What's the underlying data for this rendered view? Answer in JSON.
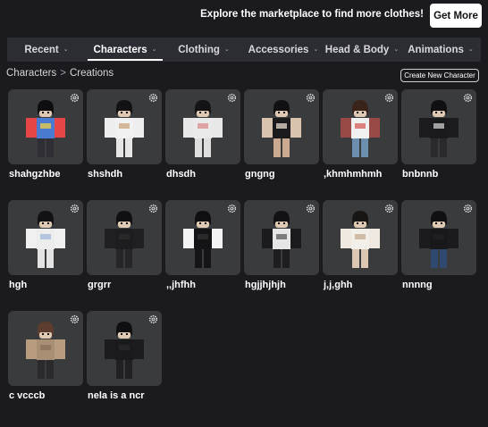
{
  "banner": {
    "text": "Explore the marketplace to find more clothes!",
    "button_label": "Get More"
  },
  "tabs": [
    {
      "label": "Recent",
      "active": false
    },
    {
      "label": "Characters",
      "active": true
    },
    {
      "label": "Clothing",
      "active": false
    },
    {
      "label": "Accessories",
      "active": false
    },
    {
      "label": "Head & Body",
      "active": false
    },
    {
      "label": "Animations",
      "active": false
    }
  ],
  "breadcrumb": {
    "parent": "Characters",
    "separator": ">",
    "current": "Creations"
  },
  "create_button": "Create New Character",
  "characters": [
    {
      "name": "shahgzhbe",
      "torso": "#4a7bd0",
      "arms": "#e64646",
      "legs": "#2e2e34",
      "hair": "#0e0e10",
      "accent": "#f2d046"
    },
    {
      "name": "shshdh",
      "torso": "#f1f1f1",
      "arms": "#eeeeee",
      "legs": "#e6e6e6",
      "hair": "#121214",
      "accent": "#c9a27a"
    },
    {
      "name": "dhsdh",
      "torso": "#eaeaea",
      "arms": "#e8e8e8",
      "legs": "#dedede",
      "hair": "#141416",
      "accent": "#d98c8c"
    },
    {
      "name": "gngng",
      "torso": "#1b1b1d",
      "arms": "#d9c3ae",
      "legs": "#caa990",
      "hair": "#111113",
      "accent": "#e9ddd0"
    },
    {
      "name": ",khmhmhmh",
      "torso": "#f0f0f0",
      "arms": "#9a4a46",
      "legs": "#6c8fb0",
      "hair": "#3a2419",
      "accent": "#d45a5a"
    },
    {
      "name": "bnbnnb",
      "torso": "#1a1a1c",
      "arms": "#1c1c1e",
      "legs": "#2a2a2c",
      "hair": "#101012",
      "accent": "#cfcfcf"
    },
    {
      "name": "hgh",
      "torso": "#ededed",
      "arms": "#f0f0f0",
      "legs": "#e4e4e4",
      "hair": "#121214",
      "accent": "#9fb7d8"
    },
    {
      "name": "grgrr",
      "torso": "#1d1d1f",
      "arms": "#202022",
      "legs": "#262628",
      "hair": "#101012",
      "accent": "#2c2c2e"
    },
    {
      "name": ",,jhfhh",
      "torso": "#141416",
      "arms": "#f3f3f3",
      "legs": "#151517",
      "hair": "#0f0f11",
      "accent": "#303032"
    },
    {
      "name": "hgjjhjhjh",
      "torso": "#e6e6e6",
      "arms": "#1b1b1d",
      "legs": "#1e1e20",
      "hair": "#121214",
      "accent": "#5a5a5c"
    },
    {
      "name": "j,j,ghh",
      "torso": "#f2eee8",
      "arms": "#efe9e2",
      "legs": "#dcc7b3",
      "hair": "#181614",
      "accent": "#c7a98f"
    },
    {
      "name": "nnnng",
      "torso": "#18181a",
      "arms": "#1b1b1d",
      "legs": "#2f4a6e",
      "hair": "#101012",
      "accent": "#222224"
    },
    {
      "name": "c vcccb",
      "torso": "#a98f74",
      "arms": "#b79c7f",
      "legs": "#2a2a2c",
      "hair": "#5c3d2e",
      "accent": "#8a6f58"
    },
    {
      "name": "nela is a ncr",
      "torso": "#1a1a1c",
      "arms": "#1c1c1e",
      "legs": "#202022",
      "hair": "#0f0f11",
      "accent": "#2a2a2c"
    }
  ]
}
